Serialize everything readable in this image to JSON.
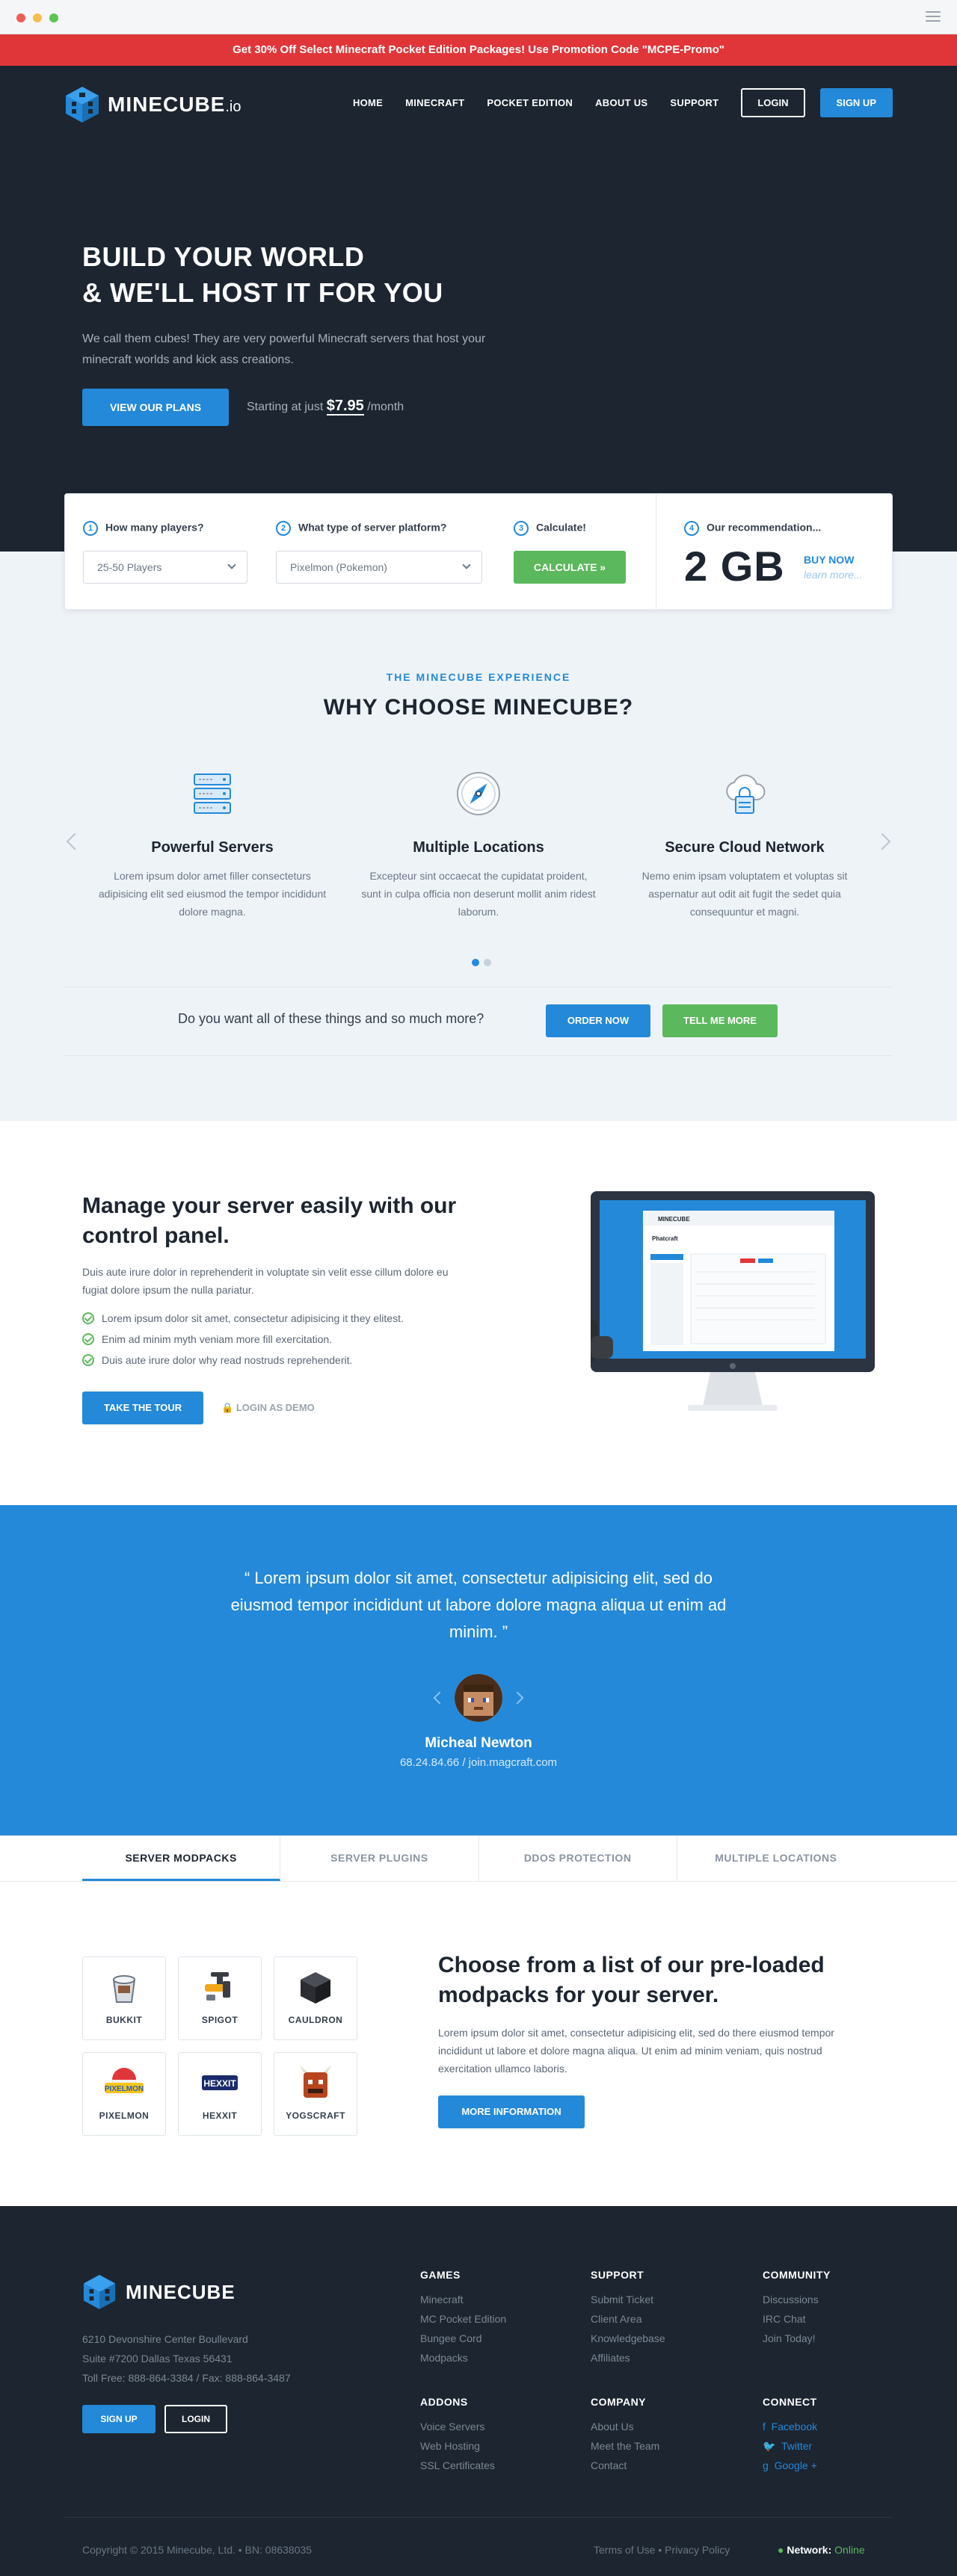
{
  "promo": {
    "text": "Get 30% Off Select Minecraft Pocket Edition Packages! Use Promotion Code \"MCPE-Promo\""
  },
  "header": {
    "brand": "MINECUBE",
    "brand_suffix": ".io",
    "nav": [
      "HOME",
      "MINECRAFT",
      "POCKET EDITION",
      "ABOUT US",
      "SUPPORT"
    ],
    "login": "LOGIN",
    "signup": "SIGN UP"
  },
  "hero": {
    "title_line1": "BUILD YOUR WORLD",
    "title_line2": "& WE'LL HOST IT FOR YOU",
    "subtitle": "We call them cubes! They are very powerful Minecraft servers that host your minecraft worlds and kick ass creations.",
    "cta": "VIEW OUR PLANS",
    "price_prefix": "Starting at just",
    "price": "$7.95",
    "price_suffix": "/month"
  },
  "calculator": {
    "steps": [
      {
        "num": "1",
        "label": "How many players?",
        "value": "25-50 Players"
      },
      {
        "num": "2",
        "label": "What type of server platform?",
        "value": "Pixelmon (Pokemon)"
      },
      {
        "num": "3",
        "label": "Calculate!",
        "button": "CALCULATE »"
      },
      {
        "num": "4",
        "label": "Our recommendation..."
      }
    ],
    "result": "2 GB",
    "buy": "BUY NOW",
    "learn": "learn more..."
  },
  "why": {
    "eyebrow": "THE MINECUBE EXPERIENCE",
    "title": "WHY CHOOSE MINECUBE?",
    "features": [
      {
        "icon": "servers-icon",
        "title": "Powerful Servers",
        "text": "Lorem ipsum dolor amet filler consecteturs adipisicing elit sed eiusmod the tempor incididunt dolore magna."
      },
      {
        "icon": "compass-icon",
        "title": "Multiple Locations",
        "text": "Excepteur sint occaecat the cupidatat proident, sunt in culpa officia non deserunt mollit anim ridest laborum."
      },
      {
        "icon": "cloud-lock-icon",
        "title": "Secure Cloud Network",
        "text": "Nemo enim ipsam voluptatem et voluptas sit aspernatur aut odit ait fugit the sedet quia consequuntur et magni."
      }
    ],
    "question": "Do you want all of these things and so much more?",
    "order": "ORDER NOW",
    "tell": "TELL ME MORE"
  },
  "control_panel": {
    "title": "Manage your server easily with our control panel.",
    "desc": "Duis aute irure dolor in reprehenderit in voluptate sin velit esse cillum dolore eu fugiat dolore ipsum the nulla pariatur.",
    "checks": [
      "Lorem ipsum dolor sit amet, consectetur adipisicing it they elitest.",
      "Enim ad minim myth veniam more fill exercitation.",
      "Duis aute irure dolor why read nostruds reprehenderit."
    ],
    "tour": "TAKE THE TOUR",
    "demo": "LOGIN AS DEMO",
    "screen_brand": "MINECUBE",
    "screen_heading": "Phatcraft"
  },
  "testimonial": {
    "quote": "“  Lorem ipsum dolor sit amet, consectetur adipisicing elit, sed do eiusmod tempor incididunt ut labore dolore magna aliqua ut enim ad minim.  ”",
    "name": "Micheal Newton",
    "sub": "68.24.84.66 / join.magcraft.com"
  },
  "tabs": [
    "SERVER MODPACKS",
    "SERVER PLUGINS",
    "DDOS PROTECTION",
    "MULTIPLE LOCATIONS"
  ],
  "modpacks": {
    "items": [
      "BUKKIT",
      "SPIGOT",
      "CAULDRON",
      "PIXELMON",
      "HEXXIT",
      "YOGSCRAFT"
    ],
    "pixelmon_logo": "PIXELMON",
    "hexxit_logo": "HEXXIT",
    "title": "Choose from a list of our pre-loaded modpacks for your server.",
    "desc": "Lorem ipsum dolor sit amet, consectetur adipisicing elit, sed do there eiusmod tempor incididunt ut labore et dolore magna aliqua. Ut enim ad minim veniam, quis nostrud exercitation ullamco laboris.",
    "button": "MORE INFORMATION"
  },
  "footer": {
    "brand": "MINECUBE",
    "address1": "6210 Devonshire Center Boullevard",
    "address2": "Suite #7200 Dallas Texas 56431",
    "phone": "Toll Free: 888-864-3384  /  Fax: 888-864-3487",
    "signup": "SIGN UP",
    "login": "LOGIN",
    "games": {
      "head": "GAMES",
      "links": [
        "Minecraft",
        "MC Pocket Edition",
        "Bungee Cord",
        "Modpacks"
      ]
    },
    "support": {
      "head": "SUPPORT",
      "links": [
        "Submit Ticket",
        "Client Area",
        "Knowledgebase",
        "Affiliates"
      ]
    },
    "community": {
      "head": "COMMUNITY",
      "links": [
        "Discussions",
        "IRC Chat",
        "Join Today!"
      ]
    },
    "addons": {
      "head": "ADDONS",
      "links": [
        "Voice Servers",
        "Web Hosting",
        "SSL Certificates"
      ]
    },
    "company": {
      "head": "COMPANY",
      "links": [
        "About Us",
        "Meet the Team",
        "Contact"
      ]
    },
    "connect": {
      "head": "CONNECT",
      "links": [
        "Facebook",
        "Twitter",
        "Google +"
      ]
    },
    "copyright": "Copyright © 2015 Minecube, Ltd.  •  BN: 08638035",
    "legal": "Terms of Use  •  Privacy Policy",
    "status_label": "Network:",
    "status_value": "Online"
  },
  "colors": {
    "promo": "#e0363a",
    "navy": "#1c2530",
    "accent": "#2489d9",
    "green": "#5cb85c"
  }
}
